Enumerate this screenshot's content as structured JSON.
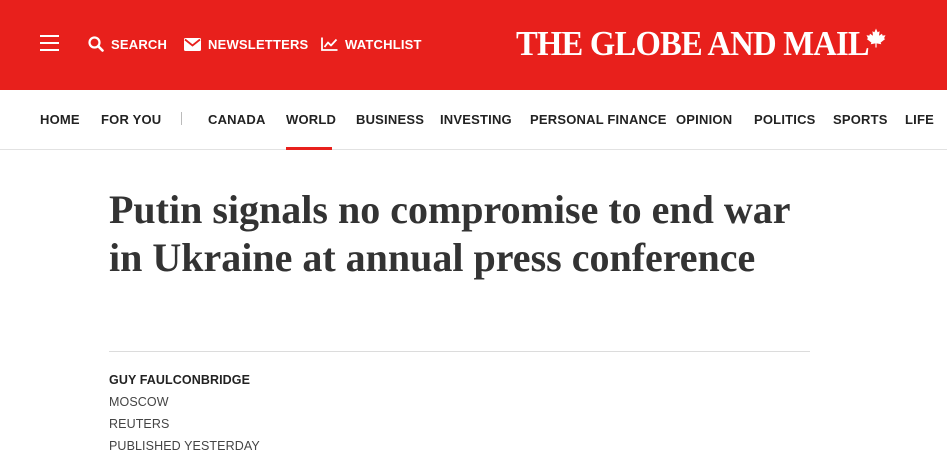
{
  "header": {
    "search_label": "SEARCH",
    "newsletters_label": "NEWSLETTERS",
    "watchlist_label": "WATCHLIST",
    "logo_text": "THE GLOBE AND MAIL",
    "brand_color": "#e8201c",
    "icons": [
      "menu-icon",
      "search-icon",
      "envelope-icon",
      "chart-line-icon",
      "maple-leaf-icon"
    ]
  },
  "nav": {
    "items": [
      "HOME",
      "FOR YOU",
      "CANADA",
      "WORLD",
      "BUSINESS",
      "INVESTING",
      "PERSONAL FINANCE",
      "OPINION",
      "POLITICS",
      "SPORTS",
      "LIFE"
    ],
    "active": "WORLD"
  },
  "article": {
    "headline": "Putin signals no compromise to end war in Ukraine at annual press conference",
    "author": "GUY FAULCONBRIDGE",
    "location": "MOSCOW",
    "source": "REUTERS",
    "published": "PUBLISHED YESTERDAY"
  }
}
